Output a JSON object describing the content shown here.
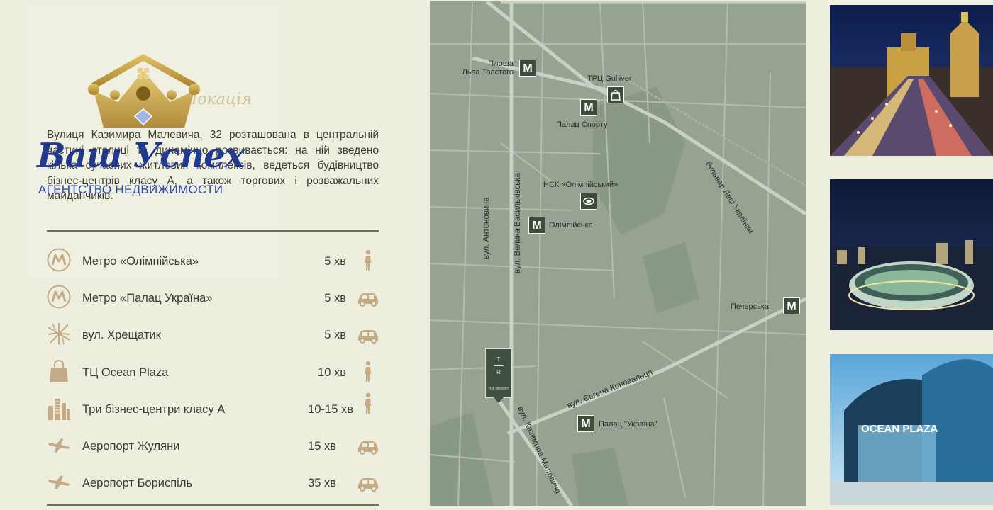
{
  "logo": {
    "name": "Ваш Успех",
    "subtitle": "АГЕНТСТВО НЕДВИЖИМОСТИ",
    "colors": {
      "crown": "#c9a53c",
      "text": "#213a8f"
    }
  },
  "section": {
    "script_title": "Локація",
    "intro": "Вулиця Казимира Малевича, 32 розташована в центральній частині столиці та динамічно розвивається: на ній зведено кілька сучасних житлових комплексів, ведеться будівництво бізнес-центрів класу А, а також торгових і розважальних майданчиків."
  },
  "distances": [
    {
      "icon": "metro-icon",
      "label": "Метро «Олімпійська»",
      "time": "5 хв",
      "mode": "walk-icon"
    },
    {
      "icon": "metro-icon",
      "label": "Метро «Палац Україна»",
      "time": "5 хв",
      "mode": "car-icon"
    },
    {
      "icon": "crossroads-icon",
      "label": "вул. Хрещатик",
      "time": "5 хв",
      "mode": "car-icon"
    },
    {
      "icon": "shopping-bag-icon",
      "label": "ТЦ Ocean Plaza",
      "time": "10 хв",
      "mode": "walk-icon"
    },
    {
      "icon": "skyscrapers-icon",
      "label": "Три бізнес-центри класу А",
      "time": "10-15 хв",
      "mode": "walk-icon"
    },
    {
      "icon": "plane-icon",
      "label": "Аеропорт Жуляни",
      "time": "15 хв",
      "mode": "car-icon"
    },
    {
      "icon": "plane-icon",
      "label": "Аеропорт Бориспіль",
      "time": "35 хв",
      "mode": "car-icon"
    }
  ],
  "map": {
    "metro_glyph": "M",
    "stations": [
      {
        "label_line1": "Площа",
        "label_line2": "Льва Толстого"
      },
      {
        "label": "Палац Спорту"
      },
      {
        "label": "Олімпійська"
      },
      {
        "label": "Печерська"
      },
      {
        "label": "Палац \"Україна\""
      }
    ],
    "pois": [
      {
        "label": "ТРЦ  Gulliver"
      },
      {
        "label": "НСК «Олімпійський»"
      }
    ],
    "streets": [
      "бульвар Лесі Українки",
      "вул. Велика Васильківська",
      "вул. Антоновича",
      "вул. Євгена Коновальця",
      "вул. Казимира Малевича"
    ],
    "pin": {
      "top": "T",
      "bottom": "R",
      "caption": "THE RESORT"
    },
    "colors": {
      "bg": "#96a392",
      "roads": "#b9c3b5",
      "park": "#8a9986",
      "marker": "#3d4c39"
    }
  },
  "photos": [
    {
      "name": "khreshchatyk-night-photo"
    },
    {
      "name": "olympic-stadium-night-photo"
    },
    {
      "name": "ocean-plaza-photo"
    }
  ],
  "colors": {
    "background": "#eeeedf",
    "accent": "#c4ab86",
    "text": "#3b3b30"
  }
}
